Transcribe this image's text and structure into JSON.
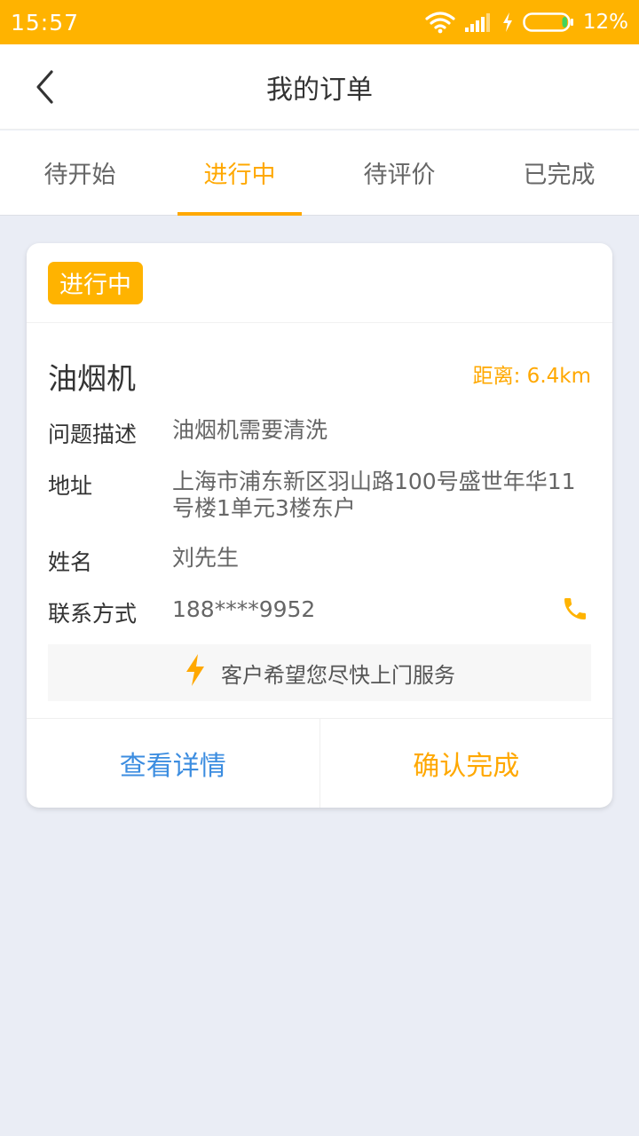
{
  "status_bar": {
    "time": "15:57",
    "battery_percent": "12%",
    "battery_level": 0.12
  },
  "header": {
    "title": "我的订单",
    "back_icon": "chevron-left-icon"
  },
  "tabs": [
    {
      "label": "待开始",
      "active": false
    },
    {
      "label": "进行中",
      "active": true
    },
    {
      "label": "待评价",
      "active": false
    },
    {
      "label": "已完成",
      "active": false
    }
  ],
  "order": {
    "status": "进行中",
    "service": "油烟机",
    "distance": "距离: 6.4km",
    "fields": [
      {
        "label": "问题描述",
        "value": "油烟机需要清洗"
      },
      {
        "label": "地址",
        "value": "上海市浦东新区羽山路100号盛世年华11号楼1单元3楼东户"
      },
      {
        "label": "姓名",
        "value": "刘先生"
      },
      {
        "label": "联系方式",
        "value": "188****9952"
      }
    ],
    "notice": "客户希望您尽快上门服务",
    "actions": {
      "detail": "查看详情",
      "confirm": "确认完成"
    }
  },
  "colors": {
    "accent": "#ffb300",
    "accent_text": "#ffa800",
    "link_blue": "#3c8de0",
    "background": "#eaedf5"
  }
}
